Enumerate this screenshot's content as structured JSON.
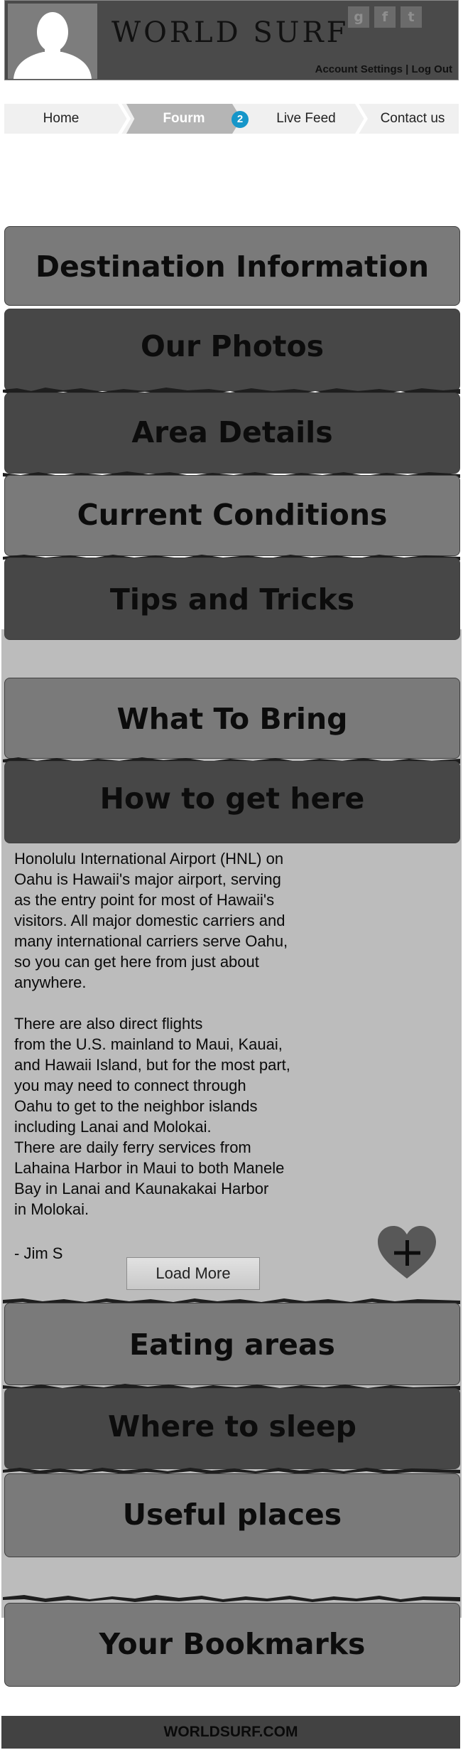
{
  "header": {
    "brand": "WORLD SURF",
    "social": [
      {
        "glyph": "g",
        "icon": "google-plus-icon"
      },
      {
        "glyph": "f",
        "icon": "facebook-icon"
      },
      {
        "glyph": "t",
        "icon": "twitter-icon"
      }
    ],
    "account_settings": "Account Settings",
    "separator": " | ",
    "log_out": "Log Out"
  },
  "nav": {
    "items": [
      "Home",
      "Fourm",
      "Live Feed",
      "Contact us"
    ],
    "badge": "2",
    "active": "Fourm"
  },
  "sections": {
    "destination": "Destination Information",
    "photos": "Our Photos",
    "area": "Area Details",
    "conditions": "Current Conditions",
    "tips": "Tips and Tricks",
    "bring": "What To Bring",
    "get_here": "How to get here",
    "eating": "Eating areas",
    "sleep": "Where to sleep",
    "useful": "Useful places",
    "bookmarks": "Your Bookmarks"
  },
  "article": {
    "body": "Honolulu International Airport (HNL) on\nOahu is Hawaii's major airport, serving\nas the entry point for most of Hawaii's\nvisitors. All major domestic carriers and\nmany international carriers serve Oahu,\nso you can get here from just about\nanywhere.\n\nThere are also direct flights\nfrom the U.S. mainland to Maui, Kauai,\nand Hawaii Island, but for the most part,\nyou may need to connect through\nOahu to get to the neighbor islands\nincluding Lanai and Molokai.\nThere are daily ferry services from\nLahaina Harbor in Maui to both Manele\nBay in Lanai and Kaunakakai Harbor\nin Molokai.",
    "author": "- Jim S",
    "load_more": "Load More",
    "favorite_icon": "heart-plus-icon"
  },
  "footer": {
    "text": "WORLDSURF.COM"
  },
  "colors": {
    "header_bg": "#4a4a4a",
    "section_light": "#7a7a7a",
    "section_dark": "#474747",
    "content_bg": "#bcbcbc",
    "badge": "#1696c9",
    "footer_bg": "#424242"
  }
}
